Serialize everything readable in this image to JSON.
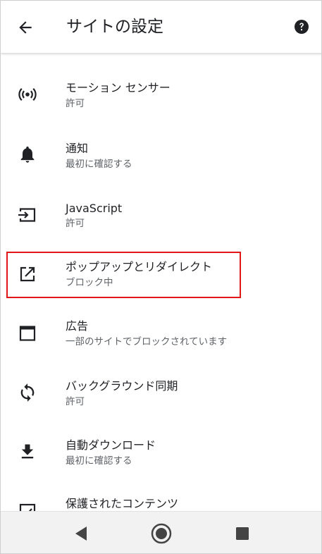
{
  "header": {
    "title": "サイトの設定"
  },
  "settings": [
    {
      "label": "モーション センサー",
      "status": "許可",
      "icon": "motion-sensor-icon"
    },
    {
      "label": "通知",
      "status": "最初に確認する",
      "icon": "bell-icon"
    },
    {
      "label": "JavaScript",
      "status": "許可",
      "icon": "javascript-icon"
    },
    {
      "label": "ポップアップとリダイレクト",
      "status": "ブロック中",
      "icon": "external-link-icon"
    },
    {
      "label": "広告",
      "status": "一部のサイトでブロックされています",
      "icon": "ads-window-icon"
    },
    {
      "label": "バックグラウンド同期",
      "status": "許可",
      "icon": "sync-icon"
    },
    {
      "label": "自動ダウンロード",
      "status": "最初に確認する",
      "icon": "download-icon"
    },
    {
      "label": "保護されたコンテンツ",
      "status": "",
      "icon": "protected-content-icon"
    }
  ],
  "navbar": {
    "icons": [
      "back-triangle-icon",
      "home-circle-icon",
      "recents-square-icon"
    ]
  },
  "colors": {
    "highlight": "#e01818",
    "text": "#202124",
    "secondary": "#5f6368",
    "icon": "#202124"
  }
}
